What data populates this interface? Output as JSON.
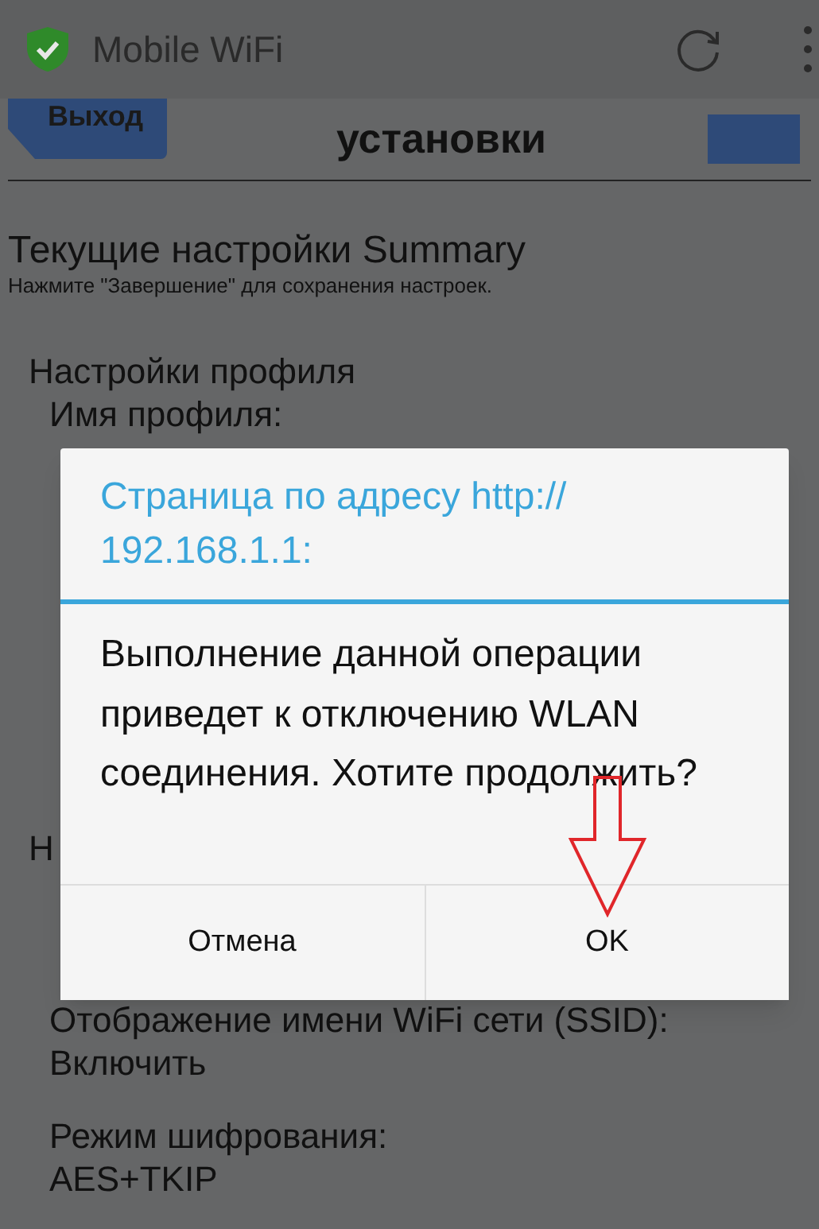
{
  "app_bar": {
    "title": "Mobile WiFi"
  },
  "page_header": {
    "back_button": "Выход",
    "title": "установки"
  },
  "summary": {
    "title": "Текущие настройки Summary",
    "hint": "Нажмите \"Завершение\" для сохранения настроек."
  },
  "sections": [
    {
      "heading": "Настройки профиля",
      "groups": [
        [
          "Имя профиля:"
        ]
      ]
    },
    {
      "heading": "Н",
      "groups": [
        [
          "Отображение имени WiFi сети (SSID):",
          "Включить"
        ],
        [
          "Режим шифрования:",
          "AES+TKIP"
        ]
      ]
    }
  ],
  "dialog": {
    "title": "Страница по адресу http:// 192.168.1.1:",
    "message": "Выполнение данной операции приведет к отключению WLAN соединения. Хотите продолжить?",
    "buttons": [
      {
        "label": "Отмена"
      },
      {
        "label": "OK"
      }
    ]
  }
}
